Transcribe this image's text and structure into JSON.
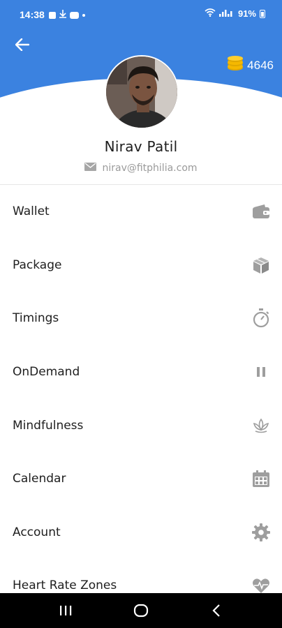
{
  "status_bar": {
    "time": "14:38",
    "battery": "91%"
  },
  "header": {
    "back_icon": "arrow-left-icon",
    "coin_icon": "coins-icon",
    "coin_count": "4646",
    "colors": {
      "primary": "#3b82e0",
      "coin": "#f5b800"
    }
  },
  "profile": {
    "name": "Nirav Patil",
    "email_icon": "mail-icon",
    "email": "nirav@fitphilia.com"
  },
  "menu": {
    "items": [
      {
        "label": "Wallet",
        "icon": "wallet-icon"
      },
      {
        "label": "Package",
        "icon": "box-icon"
      },
      {
        "label": "Timings",
        "icon": "stopwatch-icon"
      },
      {
        "label": "OnDemand",
        "icon": "pause-icon"
      },
      {
        "label": "Mindfulness",
        "icon": "lotus-icon"
      },
      {
        "label": "Calendar",
        "icon": "calendar-icon"
      },
      {
        "label": "Account",
        "icon": "gear-icon"
      },
      {
        "label": "Heart Rate Zones",
        "icon": "heart-pulse-icon"
      }
    ]
  },
  "nav_bar": {
    "recents_icon": "recents-icon",
    "home_icon": "home-icon",
    "back_icon": "back-chevron-icon"
  }
}
